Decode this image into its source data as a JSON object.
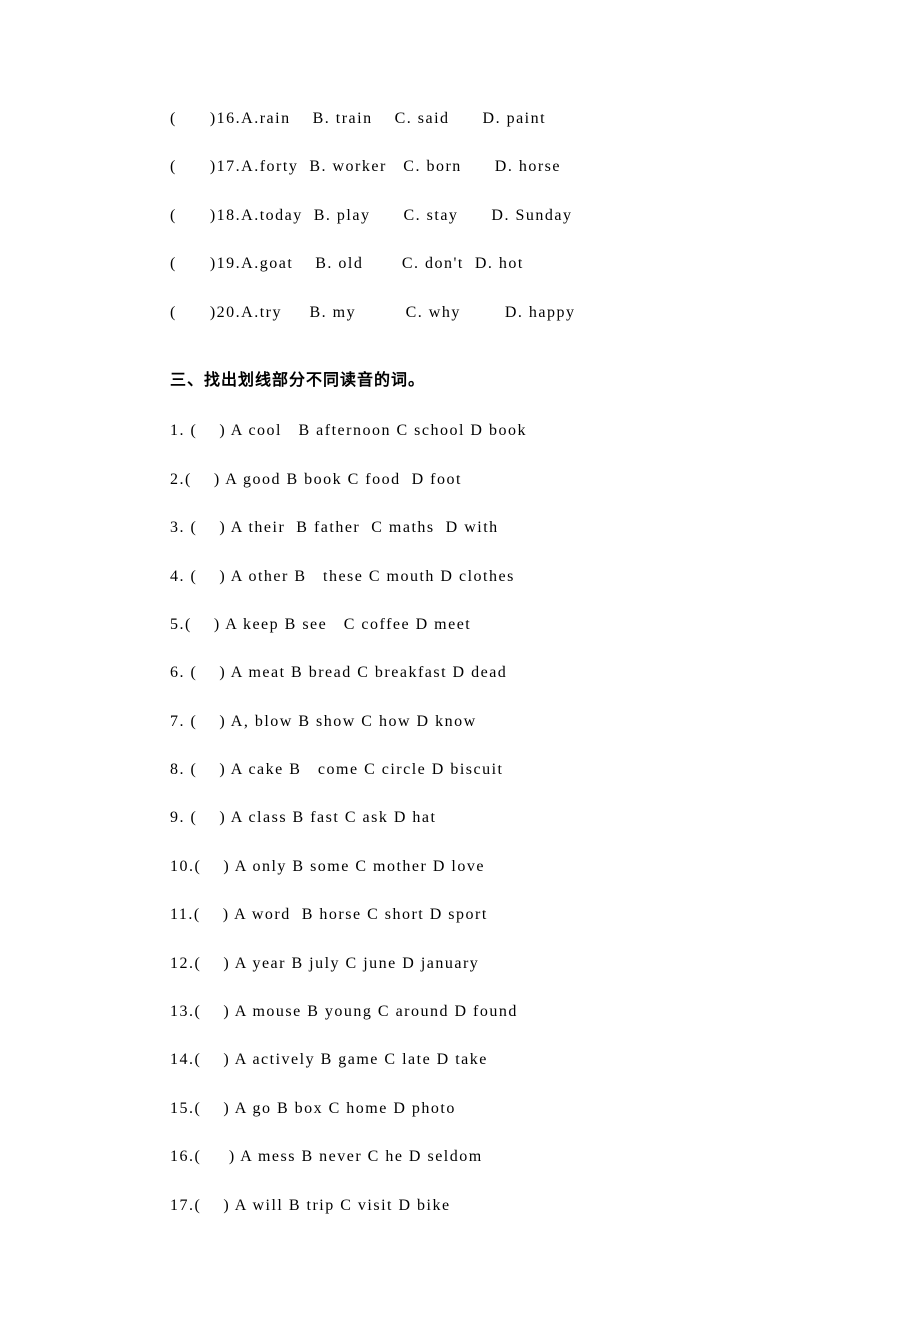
{
  "section2_continued": [
    "(      )16.A.rain    B. train    C. said      D. paint",
    "(      )17.A.forty  B. worker   C. born      D. horse",
    "(      )18.A.today  B. play      C. stay      D. Sunday",
    "(      )19.A.goat    B. old       C. don't  D. hot",
    "(      )20.A.try     B. my         C. why        D. happy"
  ],
  "section3_title": "三、找出划线部分不同读音的词。",
  "section3": [
    "1. (    ) A cool   B afternoon C school D book",
    "2.(    ) A good B book C food  D foot",
    "3. (    ) A their  B father  C maths  D with",
    "4. (    ) A other B   these C mouth D clothes",
    "5.(    ) A keep B see   C coffee D meet",
    "6. (    ) A meat B bread C breakfast D dead",
    "7. (    ) A, blow B show C how D know",
    "8. (    ) A cake B   come C circle D biscuit",
    "9. (    ) A class B fast C ask D hat",
    "10.(    ) A only B some C mother D love",
    "11.(    ) A word  B horse C short D sport",
    "12.(    ) A year B july C june D january",
    "13.(    ) A mouse B young C around D found",
    "14.(    ) A actively B game C late D take",
    "15.(    ) A go B box C home D photo",
    "16.(     ) A mess B never C he D seldom",
    "17.(    ) A will B trip C visit D bike"
  ]
}
